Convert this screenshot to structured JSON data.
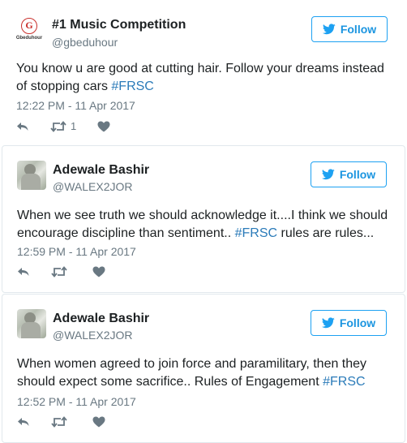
{
  "colors": {
    "accent": "#1da1f2",
    "hashtag": "#2b7bb9",
    "muted": "#697882",
    "icon": "#8899a6"
  },
  "tweets": [
    {
      "avatar": {
        "type": "logo",
        "logo_letter": "G",
        "logo_text": "Gbeduhour"
      },
      "name": "#1 Music Competition",
      "handle": "@gbeduhour",
      "follow_label": "Follow",
      "text_before": "You know u are good at cutting hair. Follow your dreams instead of stopping cars ",
      "hashtag": "#FRSC",
      "text_after": "",
      "timestamp": "12:22 PM - 11 Apr 2017",
      "retweet_count": "1"
    },
    {
      "avatar": {
        "type": "photo"
      },
      "name": "Adewale Bashir",
      "handle": "@WALEX2JOR",
      "follow_label": "Follow",
      "text_before": "When we see truth we should acknowledge it....I think we should encourage discipline than sentiment.. ",
      "hashtag": "#FRSC",
      "text_after": " rules are rules...",
      "timestamp": "12:59 PM - 11 Apr 2017",
      "retweet_count": ""
    },
    {
      "avatar": {
        "type": "photo"
      },
      "name": "Adewale Bashir",
      "handle": "@WALEX2JOR",
      "follow_label": "Follow",
      "text_before": "When women agreed to join force and paramilitary, then they should expect some sacrifice.. Rules of Engagement ",
      "hashtag": "#FRSC",
      "text_after": "",
      "timestamp": "12:52 PM - 11 Apr 2017",
      "retweet_count": ""
    }
  ],
  "icons": {
    "reply": "reply-icon",
    "retweet": "retweet-icon",
    "like": "heart-icon",
    "follow": "twitter-bird-icon"
  }
}
